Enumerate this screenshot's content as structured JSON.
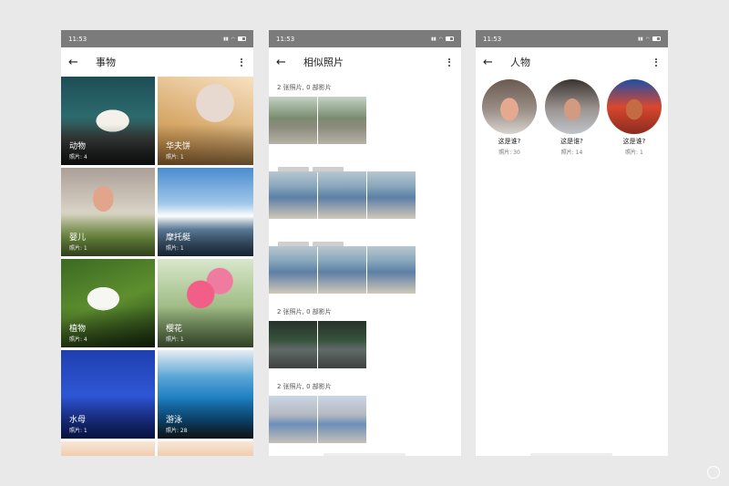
{
  "status": {
    "time": "11:53"
  },
  "things": {
    "title": "事物",
    "tiles": [
      {
        "label": "动物",
        "count": "照片: 4"
      },
      {
        "label": "华夫饼",
        "count": "照片: 1"
      },
      {
        "label": "婴儿",
        "count": "照片: 1"
      },
      {
        "label": "摩托艇",
        "count": "照片: 1"
      },
      {
        "label": "植物",
        "count": "照片: 4"
      },
      {
        "label": "樱花",
        "count": "照片: 1"
      },
      {
        "label": "水母",
        "count": "照片: 1"
      },
      {
        "label": "游泳",
        "count": "照片: 28"
      }
    ]
  },
  "similar": {
    "title": "相似照片",
    "groups": [
      {
        "header": "2 张照片, 0 部影片"
      },
      {
        "header": "2 张照片, 0 部影片"
      },
      {
        "header": "2 张照片, 0 部影片"
      }
    ]
  },
  "people": {
    "title": "人物",
    "persons": [
      {
        "name": "这是谁?",
        "count": "照片: 30"
      },
      {
        "name": "这是谁?",
        "count": "照片: 14"
      },
      {
        "name": "这是谁?",
        "count": "照片: 1"
      }
    ]
  },
  "icons": {
    "back": "back-arrow-icon",
    "more": "more-vert-icon",
    "wifi": "wifi-icon",
    "battery": "battery-icon",
    "signal": "signal-icon"
  }
}
